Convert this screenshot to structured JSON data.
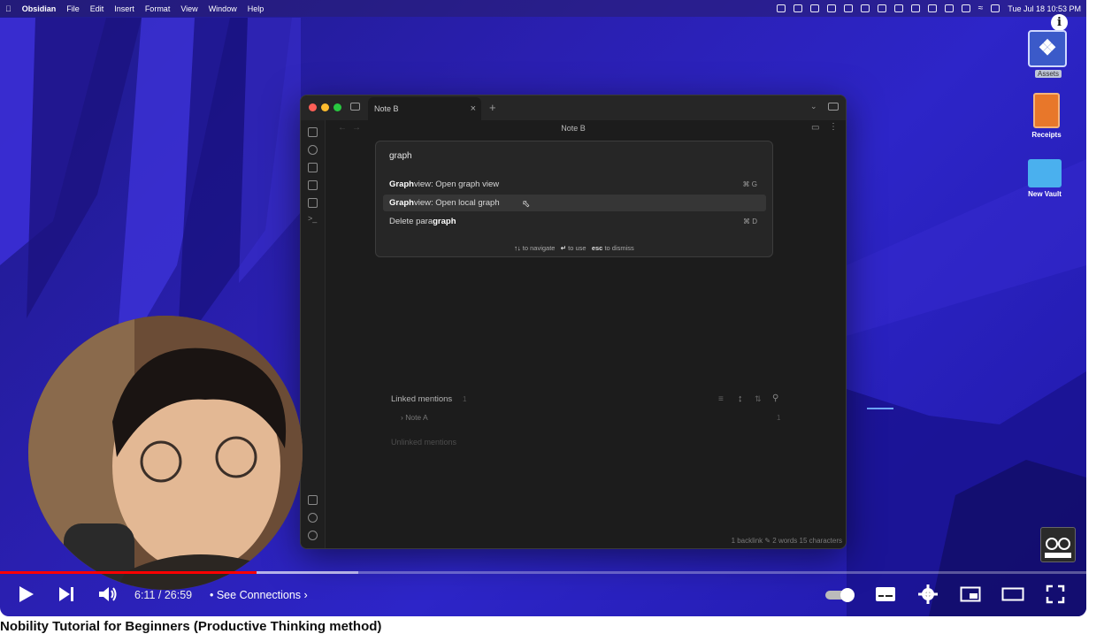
{
  "menubar": {
    "app": "Obsidian",
    "menus": [
      "File",
      "Edit",
      "Insert",
      "Format",
      "View",
      "Window",
      "Help"
    ],
    "clock": "Tue Jul 18  10:53 PM"
  },
  "desktop": {
    "icons": [
      {
        "label": "Assets"
      },
      {
        "label": "Receipts"
      },
      {
        "label": "New Vault"
      }
    ]
  },
  "window": {
    "tab_title": "Note B",
    "doc_title": "Note B",
    "palette": {
      "query": "graph",
      "results": [
        {
          "bold": "Graph",
          "rest": " view: Open graph view",
          "key": "⌘ G"
        },
        {
          "bold": "Graph",
          "rest": " view: Open local graph",
          "key": ""
        },
        {
          "pre": "Delete para",
          "bold": "graph",
          "key": "⌘ D"
        }
      ],
      "footer": {
        "nav_key": "↑↓",
        "nav_text": "to navigate",
        "use_key": "↵",
        "use_text": "to use",
        "esc_key": "esc",
        "esc_text": "to dismiss"
      }
    },
    "backlinks": {
      "linked_label": "Linked mentions",
      "linked_count": "1",
      "note": "Note A",
      "note_count": "1",
      "unlinked_label": "Unlinked mentions"
    },
    "status": "1 backlink  ✎  2 words  15 characters"
  },
  "player": {
    "progress": 0.236,
    "buffered": 0.33,
    "timecode": "6:11 / 26:59",
    "chapter": "• See Connections  ›"
  },
  "video_title": "Nobility Tutorial for Beginners (Productive Thinking method)",
  "colors": {
    "accent": "#ff0000",
    "wallpaper": "#2a1fb0",
    "window_bg": "#1c1c1c"
  }
}
